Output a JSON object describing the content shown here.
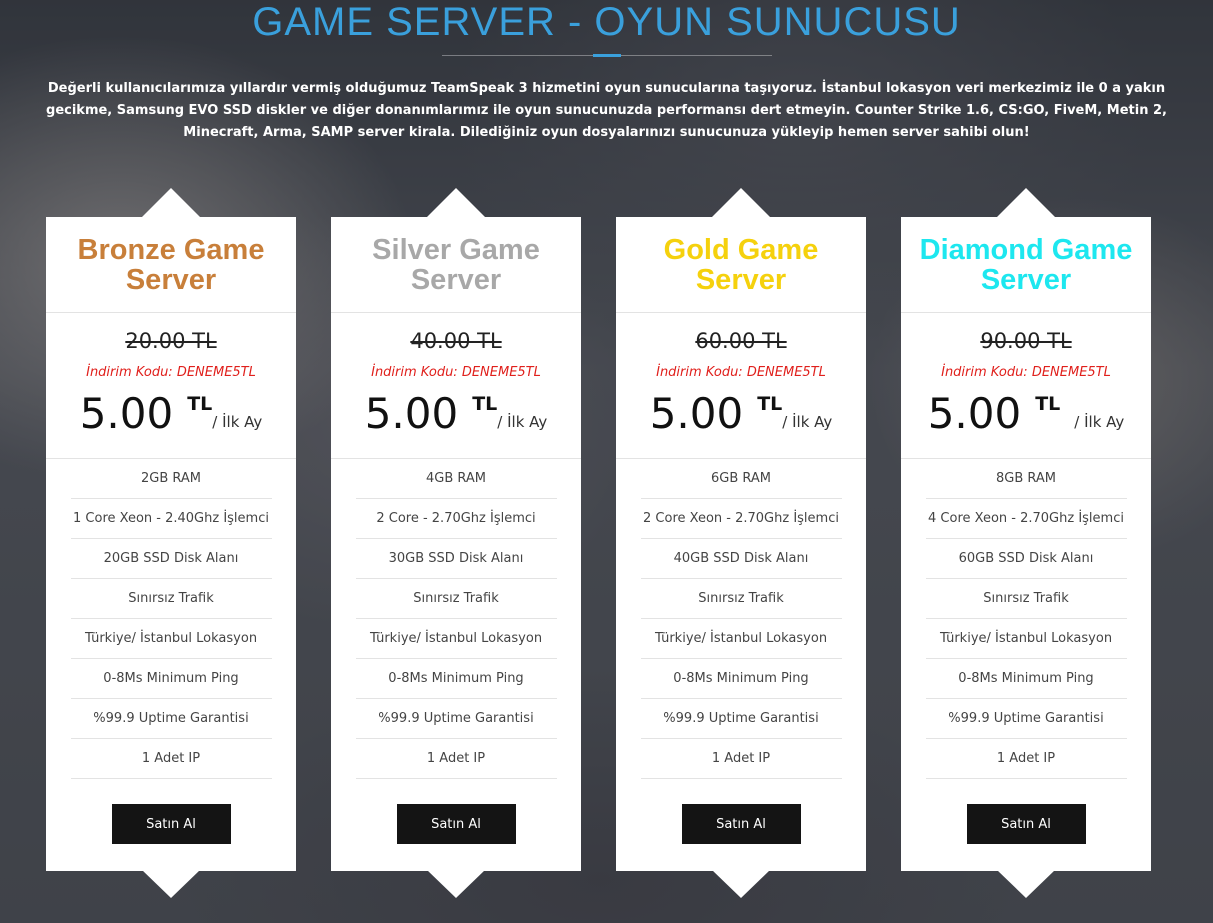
{
  "header": {
    "title": "GAME SERVER - OYUN SUNUCUSU",
    "intro": "Değerli kullanıcılarımıza yıllardır vermiş olduğumuz TeamSpeak 3 hizmetini oyun sunucularına taşıyoruz. İstanbul lokasyon veri merkezimiz ile 0 a yakın gecikme, Samsung EVO SSD diskler ve diğer donanımlarımız ile oyun sunucunuzda performansı dert etmeyin. Counter Strike 1.6, CS:GO, FiveM, Metin 2, Minecraft, Arma, SAMP server kirala. Dilediğiniz oyun dosyalarınızı sunucunuza yükleyip hemen server sahibi olun!"
  },
  "colors": {
    "accent": "#3aa0dc",
    "bronze": "#c87f3a",
    "silver": "#a8a8a8",
    "gold": "#f5d10d",
    "diamond": "#1de7ef",
    "discount": "#e0201c",
    "button": "#141414"
  },
  "plans": [
    {
      "name": "Bronze Game Server",
      "old_price": "20.00 TL",
      "discount": "İndirim Kodu: DENEME5TL",
      "price": "5.00",
      "currency": "TL",
      "period": "/ İlk Ay",
      "features": [
        "2GB RAM",
        "1 Core Xeon - 2.40Ghz İşlemci",
        "20GB SSD Disk Alanı",
        "Sınırsız Trafik",
        "Türkiye/ İstanbul Lokasyon",
        "0-8Ms Minimum Ping",
        "%99.9 Uptime Garantisi",
        "1 Adet IP"
      ],
      "button": "Satın Al"
    },
    {
      "name": "Silver Game Server",
      "old_price": "40.00 TL",
      "discount": "İndirim Kodu: DENEME5TL",
      "price": "5.00",
      "currency": "TL",
      "period": "/ İlk Ay",
      "features": [
        "4GB RAM",
        "2 Core - 2.70Ghz İşlemci",
        "30GB SSD Disk Alanı",
        "Sınırsız Trafik",
        "Türkiye/ İstanbul Lokasyon",
        "0-8Ms Minimum Ping",
        "%99.9 Uptime Garantisi",
        "1 Adet IP"
      ],
      "button": "Satın Al"
    },
    {
      "name": "Gold Game Server",
      "old_price": "60.00 TL",
      "discount": "İndirim Kodu: DENEME5TL",
      "price": "5.00",
      "currency": "TL",
      "period": "/ İlk Ay",
      "features": [
        "6GB RAM",
        "2 Core Xeon - 2.70Ghz İşlemci",
        "40GB SSD Disk Alanı",
        "Sınırsız Trafik",
        "Türkiye/ İstanbul Lokasyon",
        "0-8Ms Minimum Ping",
        "%99.9 Uptime Garantisi",
        "1 Adet IP"
      ],
      "button": "Satın Al"
    },
    {
      "name": "Diamond Game Server",
      "old_price": "90.00 TL",
      "discount": "İndirim Kodu: DENEME5TL",
      "price": "5.00",
      "currency": "TL",
      "period": "/ İlk Ay",
      "features": [
        "8GB RAM",
        "4 Core Xeon - 2.70Ghz İşlemci",
        "60GB SSD Disk Alanı",
        "Sınırsız Trafik",
        "Türkiye/ İstanbul Lokasyon",
        "0-8Ms Minimum Ping",
        "%99.9 Uptime Garantisi",
        "1 Adet IP"
      ],
      "button": "Satın Al"
    }
  ]
}
